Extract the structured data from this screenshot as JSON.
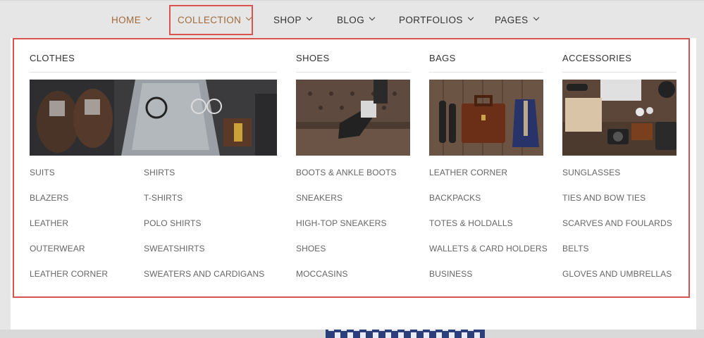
{
  "nav": {
    "home": "HOME",
    "collection": "COLLECTION",
    "shop": "SHOP",
    "blog": "BLOG",
    "portfolios": "PORTFOLIOS",
    "pages": "PAGES"
  },
  "colors": {
    "accent": "#a06a3c",
    "highlight_outline": "#d9534f"
  },
  "mega_menu": {
    "clothes": {
      "title": "CLOTHES",
      "left_links": [
        "SUITS",
        "BLAZERS",
        "LEATHER",
        "OUTERWEAR",
        "LEATHER CORNER"
      ],
      "right_links": [
        "SHIRTS",
        "T-SHIRTS",
        "POLO SHIRTS",
        "SWEATSHIRTS",
        "SWEATERS AND CARDIGANS"
      ]
    },
    "shoes": {
      "title": "SHOES",
      "links": [
        "BOOTS & ANKLE BOOTS",
        "SNEAKERS",
        "HIGH-TOP SNEAKERS",
        "SHOES",
        "MOCCASINS"
      ]
    },
    "bags": {
      "title": "BAGS",
      "links": [
        "LEATHER CORNER",
        "BACKPACKS",
        "TOTES & HOLDALLS",
        "WALLETS & CARD HOLDERS",
        "BUSINESS"
      ]
    },
    "accessories": {
      "title": "ACCESSORIES",
      "links": [
        "SUNGLASSES",
        "TIES AND BOW TIES",
        "SCARVES AND FOULARDS",
        "BELTS",
        "GLOVES AND UMBRELLAS"
      ]
    }
  }
}
